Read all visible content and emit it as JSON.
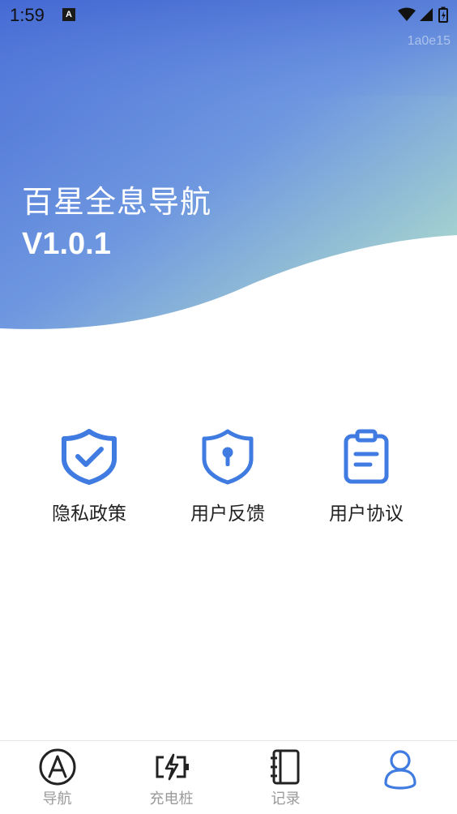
{
  "status_bar": {
    "time": "1:59",
    "notification_icon_letter": "A",
    "icons": [
      "wifi-icon",
      "signal-icon",
      "battery-icon"
    ]
  },
  "watermark": "1a0e15",
  "app": {
    "title": "百星全息导航",
    "version": "V1.0.1"
  },
  "colors": {
    "accent": "#3F7BE0",
    "gradient_top": "#4A72D6",
    "gradient_right": "#A6D6C8",
    "tab_inactive": "#9A9A9A"
  },
  "menu": {
    "items": [
      {
        "label": "隐私政策",
        "icon": "shield-check-icon"
      },
      {
        "label": "用户反馈",
        "icon": "shield-keyhole-icon"
      },
      {
        "label": "用户协议",
        "icon": "clipboard-icon"
      }
    ]
  },
  "tabs": [
    {
      "label": "导航",
      "icon": "compass-icon",
      "active": false
    },
    {
      "label": "充电桩",
      "icon": "charging-battery-icon",
      "active": false
    },
    {
      "label": "记录",
      "icon": "notebook-icon",
      "active": false
    },
    {
      "label": "",
      "icon": "user-icon",
      "active": true
    }
  ]
}
